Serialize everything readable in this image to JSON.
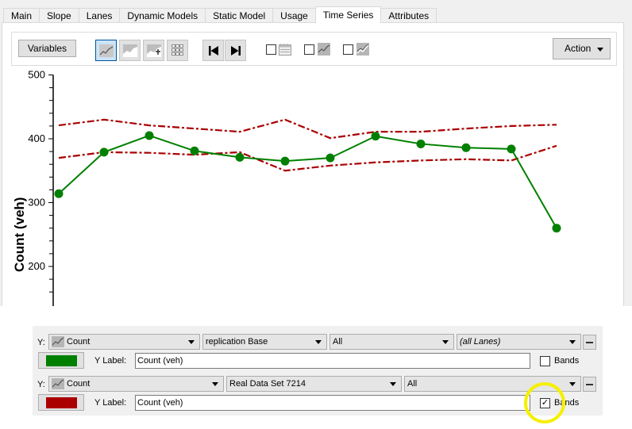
{
  "tabs": [
    {
      "label": "Main",
      "active": false
    },
    {
      "label": "Slope",
      "active": false
    },
    {
      "label": "Lanes",
      "active": false
    },
    {
      "label": "Dynamic Models",
      "active": false
    },
    {
      "label": "Static Model",
      "active": false
    },
    {
      "label": "Usage",
      "active": false
    },
    {
      "label": "Time Series",
      "active": true
    },
    {
      "label": "Attributes",
      "active": false
    }
  ],
  "toolbar": {
    "variables_label": "Variables",
    "view_buttons": [
      "line-chart-icon",
      "area-chart-icon",
      "add-chart-icon",
      "grid-icon"
    ],
    "nav_buttons": [
      "skip-first-icon",
      "skip-last-icon"
    ],
    "toggles": [
      {
        "icon": "calendar-icon",
        "checked": false
      },
      {
        "icon": "line-chart-icon",
        "checked": false
      },
      {
        "icon": "line-chart-alt-icon",
        "checked": false
      }
    ],
    "action_label": "Action"
  },
  "chart_data": {
    "type": "line",
    "title": "",
    "xlabel": "",
    "ylabel": "Count (veh)",
    "ylim": [
      150,
      500
    ],
    "yticks": [
      200,
      300,
      400,
      500
    ],
    "x": [
      1,
      2,
      3,
      4,
      5,
      6,
      7,
      8,
      9,
      10,
      11,
      12
    ],
    "series": [
      {
        "name": "replication Base - Count",
        "color": "#008000",
        "style": "solid-markers",
        "values": [
          314,
          379,
          405,
          381,
          371,
          365,
          370,
          404,
          392,
          386,
          384,
          260
        ]
      },
      {
        "name": "Real Data Set 7214 - Count (upper band)",
        "color": "#aa0000",
        "style": "dash-dot",
        "values": [
          421,
          430,
          421,
          416,
          411,
          430,
          401,
          411,
          411,
          416,
          420,
          422
        ]
      },
      {
        "name": "Real Data Set 7214 - Count (lower band)",
        "color": "#aa0000",
        "style": "dash-dot",
        "values": [
          370,
          379,
          378,
          375,
          379,
          350,
          358,
          363,
          366,
          368,
          366,
          389
        ]
      }
    ]
  },
  "series_panel": {
    "rows": [
      {
        "y_prefix": "Y:",
        "variable": "Count",
        "source": "replication Base",
        "filter": "All",
        "lanes": "(all Lanes)",
        "color": "#008000",
        "y_label_caption": "Y Label:",
        "y_label_value": "Count (veh)",
        "bands_label": "Bands",
        "bands_checked": false
      },
      {
        "y_prefix": "Y:",
        "variable": "Count",
        "source": "Real Data Set 7214",
        "filter": "All",
        "color": "#aa0000",
        "y_label_caption": "Y Label:",
        "y_label_value": "Count (veh)",
        "bands_label": "Bands",
        "bands_checked": true
      }
    ]
  }
}
